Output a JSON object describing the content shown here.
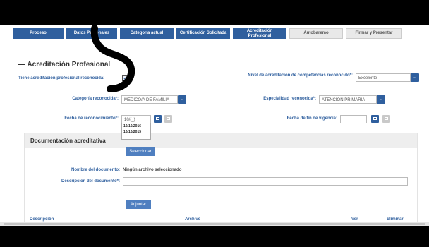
{
  "tabs": [
    {
      "label": "Proceso"
    },
    {
      "label": "Datos Personales"
    },
    {
      "label": "Categoría actual"
    },
    {
      "label": "Certificación Solicitada"
    },
    {
      "label": "Acreditación Profesional"
    },
    {
      "label": "Autobaremo"
    },
    {
      "label": "Firmar y Presentar"
    }
  ],
  "section_title": "— Acreditación Profesional",
  "form": {
    "tiene_label": "Tiene acreditación profesional reconocida:",
    "nivel_label": "Nivel de acreditación de competencias reconocido*:",
    "nivel_value": "Excelente",
    "categoria_label": "Categoría reconocida*:",
    "categoria_value": "MEDICO/A DE FAMILIA",
    "especialidad_label": "Especialidad reconocida*:",
    "especialidad_value": "ATENCION PRIMARIA",
    "fecha_label": "Fecha de reconocimiento*:",
    "fecha_value": "10/(_)",
    "fecha_fin_label": "Fecha de fin de vigencia:",
    "autocomplete": [
      "10/10/2016",
      "10/10/2015"
    ]
  },
  "docs": {
    "title": "Documentación acreditativa",
    "seleccionar_label": "Seleccionar",
    "nombre_label": "Nombre del documento:",
    "nombre_value": "Ningún archivo seleccionado",
    "descripcion_label": "Descripcion del documento*:",
    "adjuntar_label": "Adjuntar"
  },
  "table_headers": {
    "descripcion": "Descripción",
    "archivo": "Archivo",
    "ver": "Ver",
    "eliminar": "Eliminar"
  },
  "colors": {
    "accent": "#2f5f9e",
    "button": "#4f7fc0"
  }
}
